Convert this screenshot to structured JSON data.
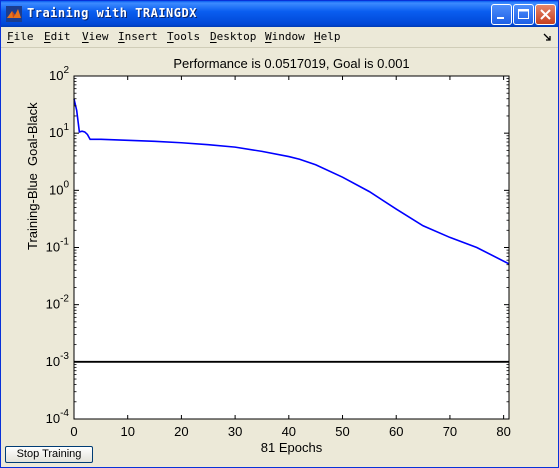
{
  "window": {
    "title": "Training with TRAINGDX"
  },
  "menubar": {
    "items": [
      {
        "label": "File",
        "accel": "F"
      },
      {
        "label": "Edit",
        "accel": "E"
      },
      {
        "label": "View",
        "accel": "V"
      },
      {
        "label": "Insert",
        "accel": "I"
      },
      {
        "label": "Tools",
        "accel": "T"
      },
      {
        "label": "Desktop",
        "accel": "D"
      },
      {
        "label": "Window",
        "accel": "W"
      },
      {
        "label": "Help",
        "accel": "H"
      }
    ]
  },
  "controls": {
    "stop_label": "Stop Training"
  },
  "chart_data": {
    "type": "line",
    "title": "Performance is 0.0517019, Goal is 0.001",
    "xlabel": "81 Epochs",
    "ylabel": "Training-Blue  Goal-Black",
    "xlim": [
      0,
      81
    ],
    "ylim": [
      0.0001,
      100
    ],
    "yscale": "log",
    "x_ticks": [
      0,
      10,
      20,
      30,
      40,
      50,
      60,
      70,
      80
    ],
    "y_ticks": [
      {
        "base": "10",
        "exp": "2",
        "value": 100
      },
      {
        "base": "10",
        "exp": "1",
        "value": 10
      },
      {
        "base": "10",
        "exp": "0",
        "value": 1
      },
      {
        "base": "10",
        "exp": "-1",
        "value": 0.1
      },
      {
        "base": "10",
        "exp": "-2",
        "value": 0.01
      },
      {
        "base": "10",
        "exp": "-3",
        "value": 0.001
      },
      {
        "base": "10",
        "exp": "-4",
        "value": 0.0001
      }
    ],
    "grid": false,
    "series": [
      {
        "name": "Training",
        "color": "#0000ff",
        "x": [
          0,
          0.5,
          1,
          1.5,
          2,
          2.5,
          3,
          5,
          10,
          15,
          20,
          25,
          30,
          35,
          40,
          42,
          45,
          50,
          55,
          60,
          65,
          70,
          75,
          81
        ],
        "y": [
          40,
          25,
          10.5,
          10.8,
          10.5,
          9.5,
          7.8,
          7.8,
          7.5,
          7.2,
          6.8,
          6.3,
          5.7,
          4.8,
          3.9,
          3.5,
          2.8,
          1.7,
          0.95,
          0.47,
          0.24,
          0.15,
          0.1,
          0.0517
        ]
      },
      {
        "name": "Goal",
        "color": "#000000",
        "x": [
          0,
          81
        ],
        "y": [
          0.001,
          0.001
        ]
      }
    ]
  }
}
